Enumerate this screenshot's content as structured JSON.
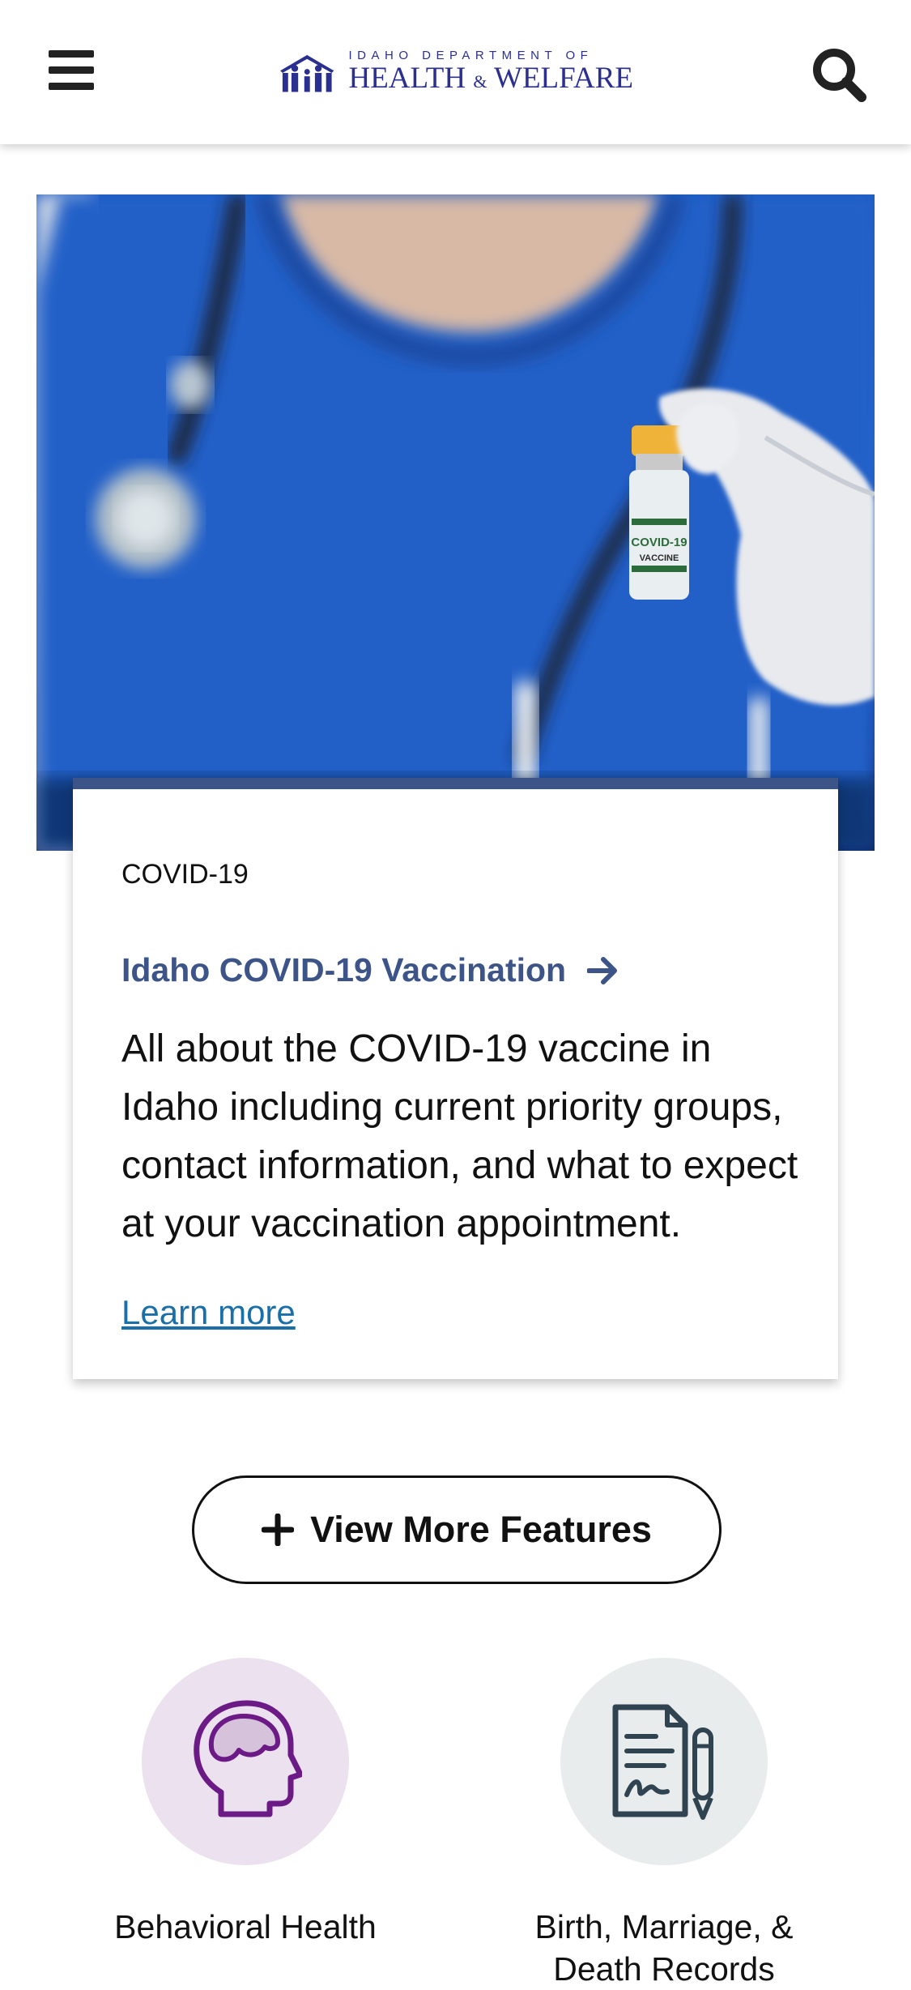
{
  "header": {
    "menu_icon": "hamburger-menu-icon",
    "search_icon": "search-icon",
    "logo": {
      "line1": "IDAHO DEPARTMENT OF",
      "line2_part1": "HEALTH",
      "line2_amp": "&",
      "line2_part2": "WELFARE",
      "color": "#2b2f8f"
    }
  },
  "hero": {
    "image_label": "COVID-19",
    "image_sublabel": "VACCINE"
  },
  "feature_card": {
    "category": "COVID-19",
    "title": "Idaho COVID-19 Vaccination",
    "description": "All about the COVID-19 vaccine in Idaho including current priority groups, contact information, and what to expect at your vaccination appointment.",
    "link_label": "Learn more",
    "accent_color": "#3d5488",
    "link_color": "#1a6fa8"
  },
  "more_button": {
    "label": "View More Features",
    "icon": "plus-icon"
  },
  "tiles": [
    {
      "label": "Behavioral Health",
      "icon": "head-brain-icon",
      "bg": "#ece1ee",
      "icon_color": "#6b1a86"
    },
    {
      "label": "Birth, Marriage, & Death Records",
      "icon": "document-pen-icon",
      "bg": "#e9ecec",
      "icon_color": "#2f4450"
    }
  ]
}
